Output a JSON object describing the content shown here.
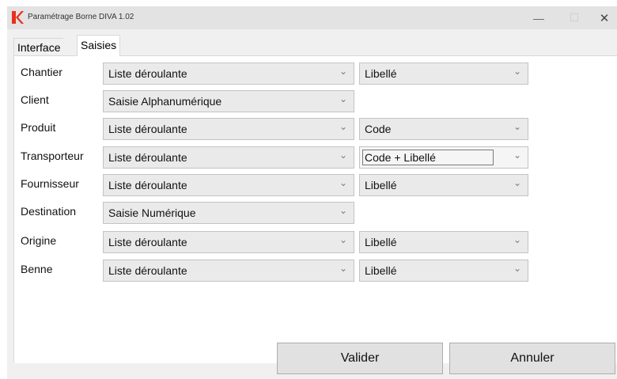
{
  "window": {
    "title": "Paramétrage Borne DIVA 1.02",
    "controls": {
      "minimize": "—",
      "maximize": "☐",
      "close": "✕"
    }
  },
  "tabs": [
    {
      "label": "Interface",
      "selected": false
    },
    {
      "label": "Saisies",
      "selected": true
    }
  ],
  "fields": [
    {
      "label": "Chantier",
      "main": "Liste déroulante",
      "secondary": "Libellé"
    },
    {
      "label": "Client",
      "main": "Saisie Alphanumérique",
      "secondary": null
    },
    {
      "label": "Produit",
      "main": "Liste déroulante",
      "secondary": "Code"
    },
    {
      "label": "Transporteur",
      "main": "Liste déroulante",
      "secondary": "Code + Libellé"
    },
    {
      "label": "Fournisseur",
      "main": "Liste déroulante",
      "secondary": "Libellé"
    },
    {
      "label": "Destination",
      "main": "Saisie Numérique",
      "secondary": null
    },
    {
      "label": "Origine",
      "main": "Liste déroulante",
      "secondary": "Libellé"
    },
    {
      "label": "Benne",
      "main": "Liste déroulante",
      "secondary": "Libellé"
    }
  ],
  "buttons": {
    "ok": "Valider",
    "cancel": "Annuler"
  },
  "icons": {
    "app": "k-logo-icon",
    "dropdown": "chevron-down-icon"
  },
  "colors": {
    "logo": "#e8301c",
    "titlebar": "#e3e3e3",
    "window": "#f0f0f0",
    "combo": "#eaeaea"
  }
}
